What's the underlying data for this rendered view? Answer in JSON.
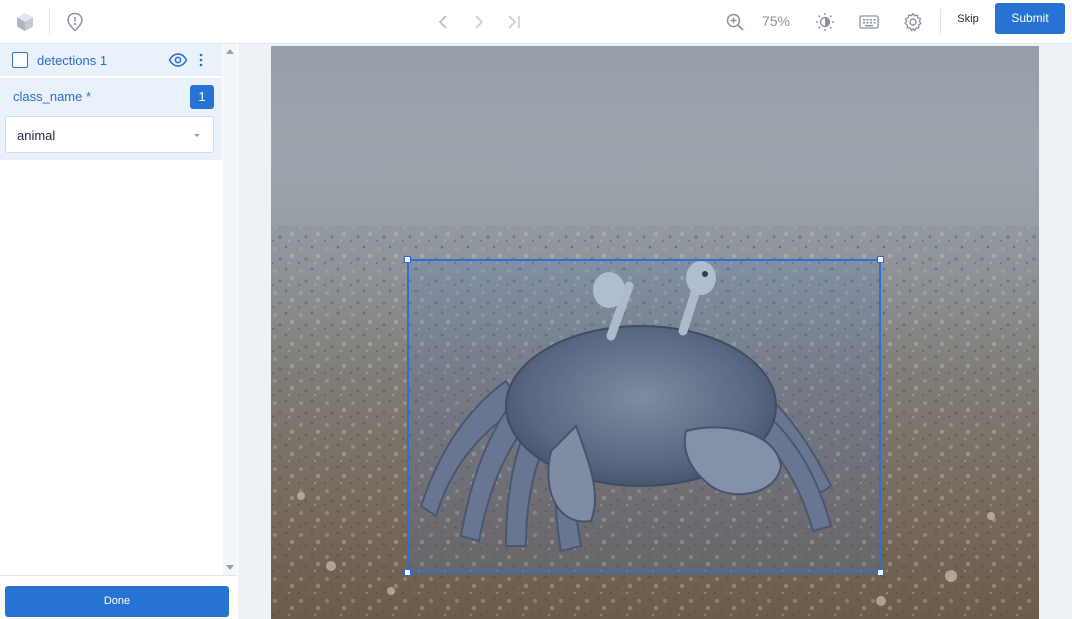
{
  "toolbar": {
    "zoom_level": "75%",
    "skip_label": "Skip",
    "submit_label": "Submit"
  },
  "sidebar": {
    "detection": {
      "title": "detections 1",
      "attribute_label": "class_name *",
      "attribute_count": "1",
      "class_value": "animal"
    },
    "done_label": "Done"
  },
  "colors": {
    "accent": "#2673d4",
    "panel_highlight": "#e9f1fb",
    "bbox_stroke": "#2f6fd0"
  },
  "icons": [
    "app-logo-icon",
    "issue-report-icon",
    "previous-icon",
    "next-icon",
    "skip-to-end-icon",
    "zoom-in-icon",
    "brightness-icon",
    "keyboard-icon",
    "settings-icon",
    "visibility-eye-icon",
    "more-options-icon",
    "chevron-down-icon"
  ]
}
